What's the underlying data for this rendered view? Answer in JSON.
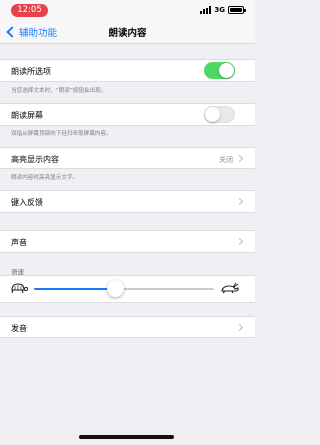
{
  "status_bar": {
    "time": "12:05",
    "network": "3G",
    "signal_bars": 4,
    "battery_level": 1.0
  },
  "nav": {
    "back_label": "辅助功能",
    "title": "朗读内容"
  },
  "speak_selection": {
    "label": "朗读所选项",
    "enabled": true,
    "footer": "当您选择文本时，“朗读”按钮会出现。"
  },
  "speak_screen": {
    "label": "朗读屏幕",
    "enabled": false,
    "footer": "双指从屏幕顶部向下轻扫听取屏幕内容。"
  },
  "highlight_content": {
    "label": "高亮显示内容",
    "value": "关闭",
    "footer": "朗读内容时高亮显示文字。"
  },
  "typing_feedback": {
    "label": "键入反馈"
  },
  "voices": {
    "label": "声音"
  },
  "speaking_rate": {
    "header": "语速",
    "value_fraction": 0.45
  },
  "pronunciations": {
    "label": "发音"
  },
  "colors": {
    "accent": "#1a7cf5",
    "toggle_on": "#4cd964",
    "time_pill": "#e8434c"
  },
  "icons": {
    "back": "chevron-left-icon",
    "disclosure": "chevron-right-icon",
    "slow": "turtle-icon",
    "fast": "hare-icon"
  }
}
